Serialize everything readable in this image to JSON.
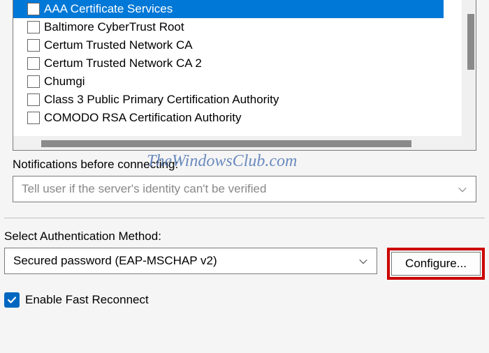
{
  "certs": {
    "items": [
      {
        "label": "AAA Certificate Services",
        "selected": true
      },
      {
        "label": "Baltimore CyberTrust Root",
        "selected": false
      },
      {
        "label": "Certum Trusted Network CA",
        "selected": false
      },
      {
        "label": "Certum Trusted Network CA 2",
        "selected": false
      },
      {
        "label": "Chumgi",
        "selected": false
      },
      {
        "label": "Class 3 Public Primary Certification Authority",
        "selected": false
      },
      {
        "label": "COMODO RSA Certification Authority",
        "selected": false
      }
    ]
  },
  "notifications": {
    "label": "Notifications before connecting:",
    "selected": "Tell user if the server's identity can't be verified"
  },
  "auth": {
    "label": "Select Authentication Method:",
    "selected": "Secured password (EAP-MSCHAP v2)",
    "configure_label": "Configure..."
  },
  "fast_reconnect": {
    "checked": true,
    "label": "Enable Fast Reconnect"
  },
  "watermark": "TheWindowsClub.com"
}
